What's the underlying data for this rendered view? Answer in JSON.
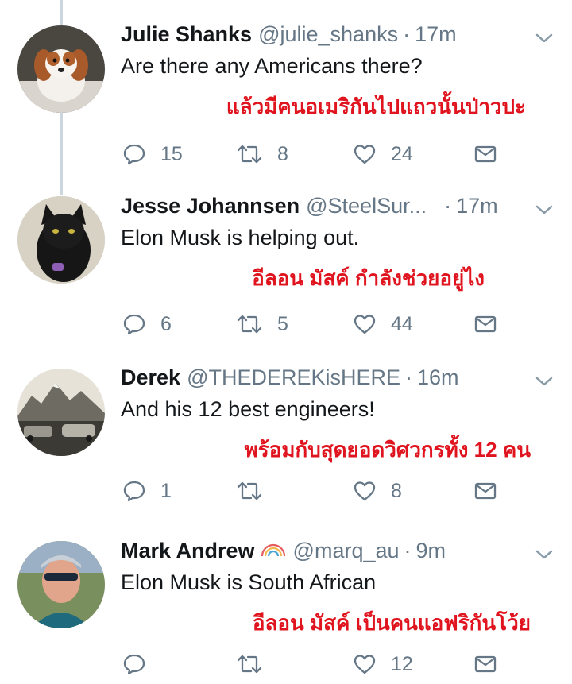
{
  "tweets": [
    {
      "name": "Julie Shanks",
      "handle": "@julie_shanks",
      "separator": "·",
      "time": "17m",
      "text": "Are there any Americans there?",
      "translation": "แล้วมีคนอเมริกันไปแถวนั้นป่าวปะ",
      "replies": "15",
      "retweets": "8",
      "likes": "24"
    },
    {
      "name": "Jesse Johannsen",
      "handle": "@SteelSur...",
      "separator": "·",
      "time": "17m",
      "text": "Elon Musk is helping out.",
      "translation": "อีลอน มัสค์ กำลังช่วยอยู่ไง",
      "replies": "6",
      "retweets": "5",
      "likes": "44"
    },
    {
      "name": "Derek",
      "handle": "@THEDEREKisHERE",
      "separator": "·",
      "time": "16m",
      "text": "And his 12 best engineers!",
      "translation": "พร้อมกับสุดยอดวิศวกรทั้ง 12 คน",
      "replies": "1",
      "retweets": "",
      "likes": "8"
    },
    {
      "name": "Mark Andrew",
      "handle": "@marq_au",
      "separator": "·",
      "time": "9m",
      "text": "Elon Musk is South African",
      "translation": "อีลอน มัสค์ เป็นคนแอฟริกันโว้ย",
      "replies": "",
      "retweets": "",
      "likes": "12"
    }
  ],
  "icons": {
    "reply": "reply-icon",
    "retweet": "retweet-icon",
    "like": "heart-icon",
    "dm": "envelope-icon",
    "menu": "chevron-down-icon",
    "badge": "rainbow-icon"
  },
  "colors": {
    "translation": "#e0141e",
    "secondary_text": "#657786",
    "icon": "#657786"
  }
}
